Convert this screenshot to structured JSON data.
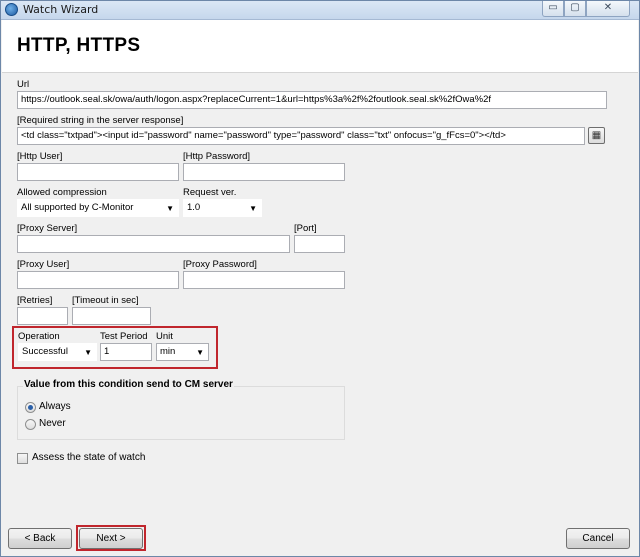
{
  "window": {
    "title": "Watch Wizard",
    "min_glyph": "▭",
    "max_glyph": "▢",
    "close_glyph": "✕"
  },
  "page": {
    "heading": "HTTP, HTTPS"
  },
  "form": {
    "url_label": "Url",
    "url_value": "https://outlook.seal.sk/owa/auth/logon.aspx?replaceCurrent=1&url=https%3a%2f%2foutlook.seal.sk%2fOwa%2f",
    "required_label": "[Required string in the server response]",
    "required_value": "<td class=\"txtpad\"><input id=\"password\" name=\"password\" type=\"password\" class=\"txt\" onfocus=\"g_fFcs=0\"></td>",
    "http_user_label": "[Http User]",
    "http_user_value": "",
    "http_password_label": "[Http Password]",
    "http_password_value": "",
    "compression_label": "Allowed compression",
    "compression_value": "All supported by C-Monitor",
    "request_ver_label": "Request ver.",
    "request_ver_value": "1.0",
    "proxy_server_label": "[Proxy Server]",
    "proxy_server_value": "",
    "port_label": "[Port]",
    "port_value": "",
    "proxy_user_label": "[Proxy User]",
    "proxy_user_value": "",
    "proxy_password_label": "[Proxy Password]",
    "proxy_password_value": "",
    "retries_label": "[Retries]",
    "retries_value": "",
    "timeout_label": "[Timeout in sec]",
    "timeout_value": "",
    "operation_label": "Operation",
    "operation_value": "Successful",
    "test_period_label": "Test Period",
    "test_period_value": "1",
    "unit_label": "Unit",
    "unit_value": "min",
    "group_title": "Value from this condition send to CM server",
    "radio_always": "Always",
    "radio_never": "Never",
    "radio_selected": "Always",
    "assess_label": "Assess the state of watch",
    "assess_checked": false
  },
  "footer": {
    "back_label": "< Back",
    "next_label": "Next >",
    "cancel_label": "Cancel"
  },
  "colors": {
    "highlight": "#c0262d",
    "radio_dot": "#2a5fa8"
  }
}
